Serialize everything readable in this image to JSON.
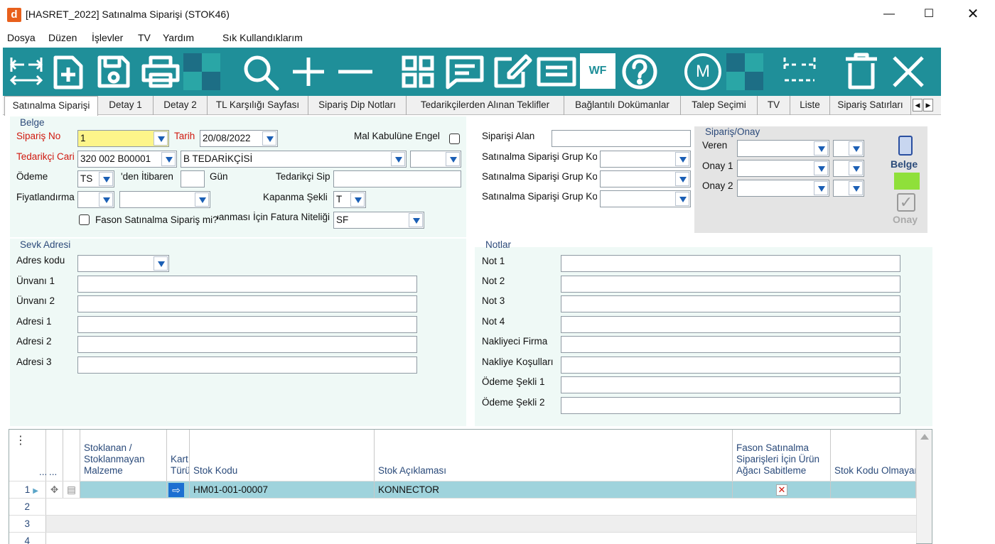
{
  "window": {
    "title": "[HASRET_2022] Satınalma Siparişi (STOK46)",
    "app_icon_letter": "d"
  },
  "menu": [
    "Dosya",
    "Düzen",
    "İşlevler",
    "TV",
    "Yardım",
    "Sık Kullandıklarım"
  ],
  "toolbar": {
    "buttons": [
      "first-last-icon",
      "new-document-icon",
      "save-icon",
      "print-icon",
      "search-icon",
      "add-icon",
      "remove-icon",
      "grid-view-icon",
      "message-icon",
      "edit-icon",
      "list-icon",
      "workflow-icon",
      "help-icon",
      "m-icon",
      "navigate-icon",
      "delete-icon",
      "close-icon"
    ],
    "wf_label": "WF",
    "m_label": "M",
    "colors": {
      "background": "#1f8f99",
      "icon": "#ffffff"
    }
  },
  "tabs": [
    "Satınalma Siparişi",
    "Detay 1",
    "Detay 2",
    "TL Karşılığı Sayfası",
    "Sipariş Dip Notları",
    "Tedarikçilerden Alınan Teklifler",
    "Bağlantılı Dokümanlar",
    "Talep Seçimi",
    "TV",
    "Liste",
    "Sipariş Satırları"
  ],
  "belge": {
    "title": "Belge",
    "siparis_no_label": "Sipariş No",
    "siparis_no_value": "1",
    "tarih_label": "Tarih",
    "tarih_value": "20/08/2022",
    "mal_kabul_label": "Mal Kabulüne Engel",
    "tedarikci_label": "Tedarikçi Cari",
    "tedarikci_code": "320 002 B00001",
    "tedarikci_name": "B TEDARİKÇİSİ",
    "odeme_label": "Ödeme",
    "odeme_value": "TS",
    "itibaren_label": "'den İtibaren",
    "gun_label": "Gün",
    "tedarikci_sip_label": "Tedarikçi Sipariş",
    "fiyatlandirma_label": "Fiyatlandırma",
    "kapanma_label": "Kapanma Şekli",
    "kapanma_value": "T",
    "fason_label": "Fason Satınalma Sipariş mi?",
    "fatura_label": "Kapanması İçin Fatura Niteliği",
    "fatura_value": "SF"
  },
  "right_top": {
    "siparisi_alan_label": "Siparişi Alan",
    "grup_labels": [
      "Satınalma Siparişi Grup Kodu",
      "Satınalma Siparişi Grup Kodu",
      "Satınalma Siparişi Grup Kodu"
    ]
  },
  "onay": {
    "title": "Sipariş/Onay",
    "veren_label": "Veren",
    "onay1_label": "Onay 1",
    "onay2_label": "Onay 2",
    "belge_label": "Belge",
    "onay_label": "Onay",
    "colors": {
      "green": "#8fe03a",
      "panel": "#e4e4e4"
    }
  },
  "sevk": {
    "title": "Sevk Adresi",
    "labels": [
      "Adres kodu",
      "Ünvanı 1",
      "Ünvanı 2",
      "Adresi 1",
      "Adresi 2",
      "Adresi 3"
    ]
  },
  "notlar": {
    "title": "Notlar",
    "labels": [
      "Not 1",
      "Not 2",
      "Not 3",
      "Not 4",
      "Nakliyeci Firma",
      "Nakliye Koşulları",
      "Ödeme Şekli 1",
      "Ödeme Şekli 2"
    ]
  },
  "grid": {
    "menu_glyph": "⋮",
    "col_dots1": "...",
    "col_dots2": "...",
    "headers": {
      "stoklanan": "Stoklanan / Stoklanmayan Malzeme",
      "kart": "Kart Türü",
      "stok_kodu": "Stok Kodu",
      "stok_aciklama": "Stok Açıklaması",
      "fason": "Fason Satınalma Siparişleri İçin Ürün Ağacı Sabitleme",
      "stok_kodu_olmayan": "Stok Kodu Olmayan"
    },
    "rows": [
      {
        "no": "1",
        "stok_kodu": "HM01-001-00007",
        "aciklama": "KONNECTOR"
      },
      {
        "no": "2",
        "stok_kodu": "",
        "aciklama": ""
      },
      {
        "no": "3",
        "stok_kodu": "",
        "aciklama": ""
      },
      {
        "no": "4",
        "stok_kodu": "",
        "aciklama": ""
      }
    ],
    "colors": {
      "selected_row": "#9fd3dc",
      "alt_row": "#eeeeee"
    }
  }
}
